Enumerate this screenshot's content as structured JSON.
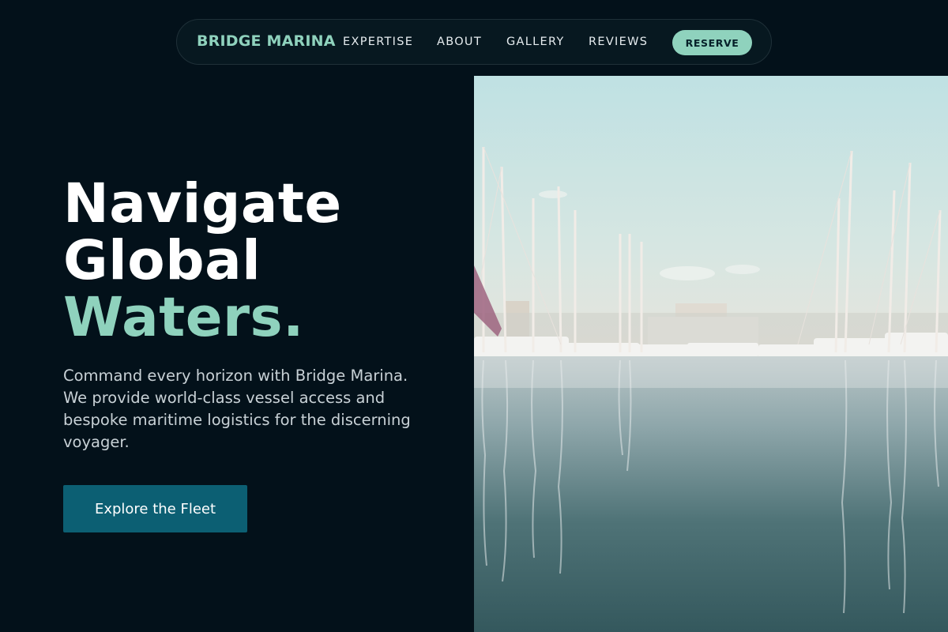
{
  "nav": {
    "brand": "BRIDGE MARINA",
    "links": [
      "EXPERTISE",
      "ABOUT",
      "GALLERY",
      "REVIEWS"
    ],
    "reserve_label": "RESERVE"
  },
  "hero": {
    "headline_lines": [
      "Navigate",
      "Global"
    ],
    "headline_accent": "Waters.",
    "description": "Command every horizon with Bridge Marina. We provide world-class vessel access and bespoke maritime logistics for the discerning voyager.",
    "cta_label": "Explore the Fleet"
  },
  "image": {
    "subject": "marina-sailboats-photo"
  },
  "colors": {
    "background": "#03111a",
    "accent": "#8fd2bd",
    "cta": "#0c5f73",
    "text_muted": "#c8d1d6"
  }
}
